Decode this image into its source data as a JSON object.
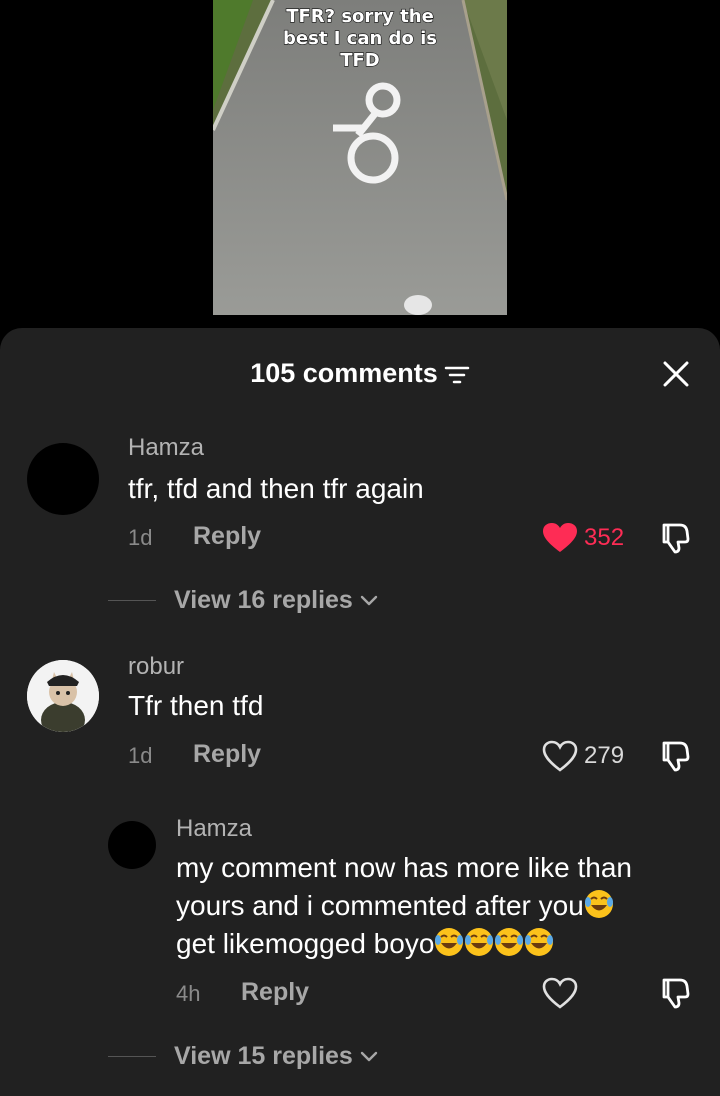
{
  "video": {
    "caption_lines": [
      "TFR? sorry the",
      "best I can do is",
      "TFD"
    ]
  },
  "header": {
    "count_label": "105 comments"
  },
  "comments": [
    {
      "username": "Hamza",
      "text": "tfr, tfd and then tfr again",
      "time": "1d",
      "reply_label": "Reply",
      "likes": "352",
      "liked": true,
      "view_replies": "View 16 replies"
    },
    {
      "username": "robur",
      "text": "Tfr then tfd",
      "time": "1d",
      "reply_label": "Reply",
      "likes": "279",
      "liked": false
    }
  ],
  "reply": {
    "username": "Hamza",
    "lines": [
      "my comment now has more like than",
      "yours and i commented after you",
      "get likemogged boyo"
    ],
    "emoji": "face-with-tears-of-joy",
    "time": "4h",
    "reply_label": "Reply",
    "likes": "",
    "liked": false
  },
  "footer": {
    "view_replies": "View 15 replies"
  },
  "colors": {
    "sheet_bg": "#212121",
    "like_red": "#fe2c55",
    "muted_text": "#a7a7a7"
  }
}
